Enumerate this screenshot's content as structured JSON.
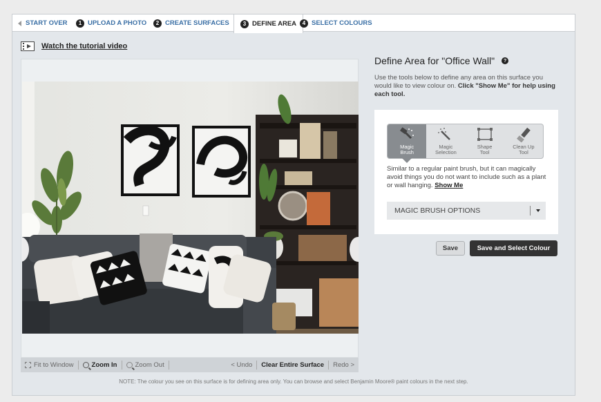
{
  "steps": {
    "start_over": "START OVER",
    "items": [
      {
        "num": "1",
        "label": "UPLOAD A PHOTO"
      },
      {
        "num": "2",
        "label": "CREATE SURFACES"
      },
      {
        "num": "3",
        "label": "DEFINE AREA"
      },
      {
        "num": "4",
        "label": "SELECT COLOURS"
      }
    ],
    "active_index": 2
  },
  "tutorial": {
    "icon": "film-icon",
    "label": "Watch the tutorial video"
  },
  "canvas_toolbar": {
    "fit": "Fit to Window",
    "zoom_in": "Zoom In",
    "zoom_out": "Zoom Out",
    "undo": "< Undo",
    "clear": "Clear Entire Surface",
    "redo": "Redo >"
  },
  "note": "NOTE: The colour you see on this surface is for defining area only. You can browse and select Benjamin Moore® paint colours in the next step.",
  "panel": {
    "title": "Define Area for \"Office Wall\"",
    "help": "?",
    "desc_plain": "Use the tools below to define any area on this surface you would like to view colour on. ",
    "desc_bold": "Click \"Show Me\" for help using each tool.",
    "tools": [
      {
        "line1": "Magic",
        "line2": "Brush",
        "icon": "magic-brush-icon",
        "active": true
      },
      {
        "line1": "Magic",
        "line2": "Selection",
        "icon": "magic-selection-icon",
        "active": false
      },
      {
        "line1": "Shape",
        "line2": "Tool",
        "icon": "shape-tool-icon",
        "active": false
      },
      {
        "line1": "Clean Up",
        "line2": "Tool",
        "icon": "clean-up-tool-icon",
        "active": false
      }
    ],
    "tool_desc": "Similar to a regular paint brush, but it can magically avoid things you do not want to include such as a plant or wall hanging. ",
    "show_me": "Show Me",
    "options_label": "MAGIC BRUSH OPTIONS",
    "save": "Save",
    "save_select": "Save and Select Colour"
  }
}
